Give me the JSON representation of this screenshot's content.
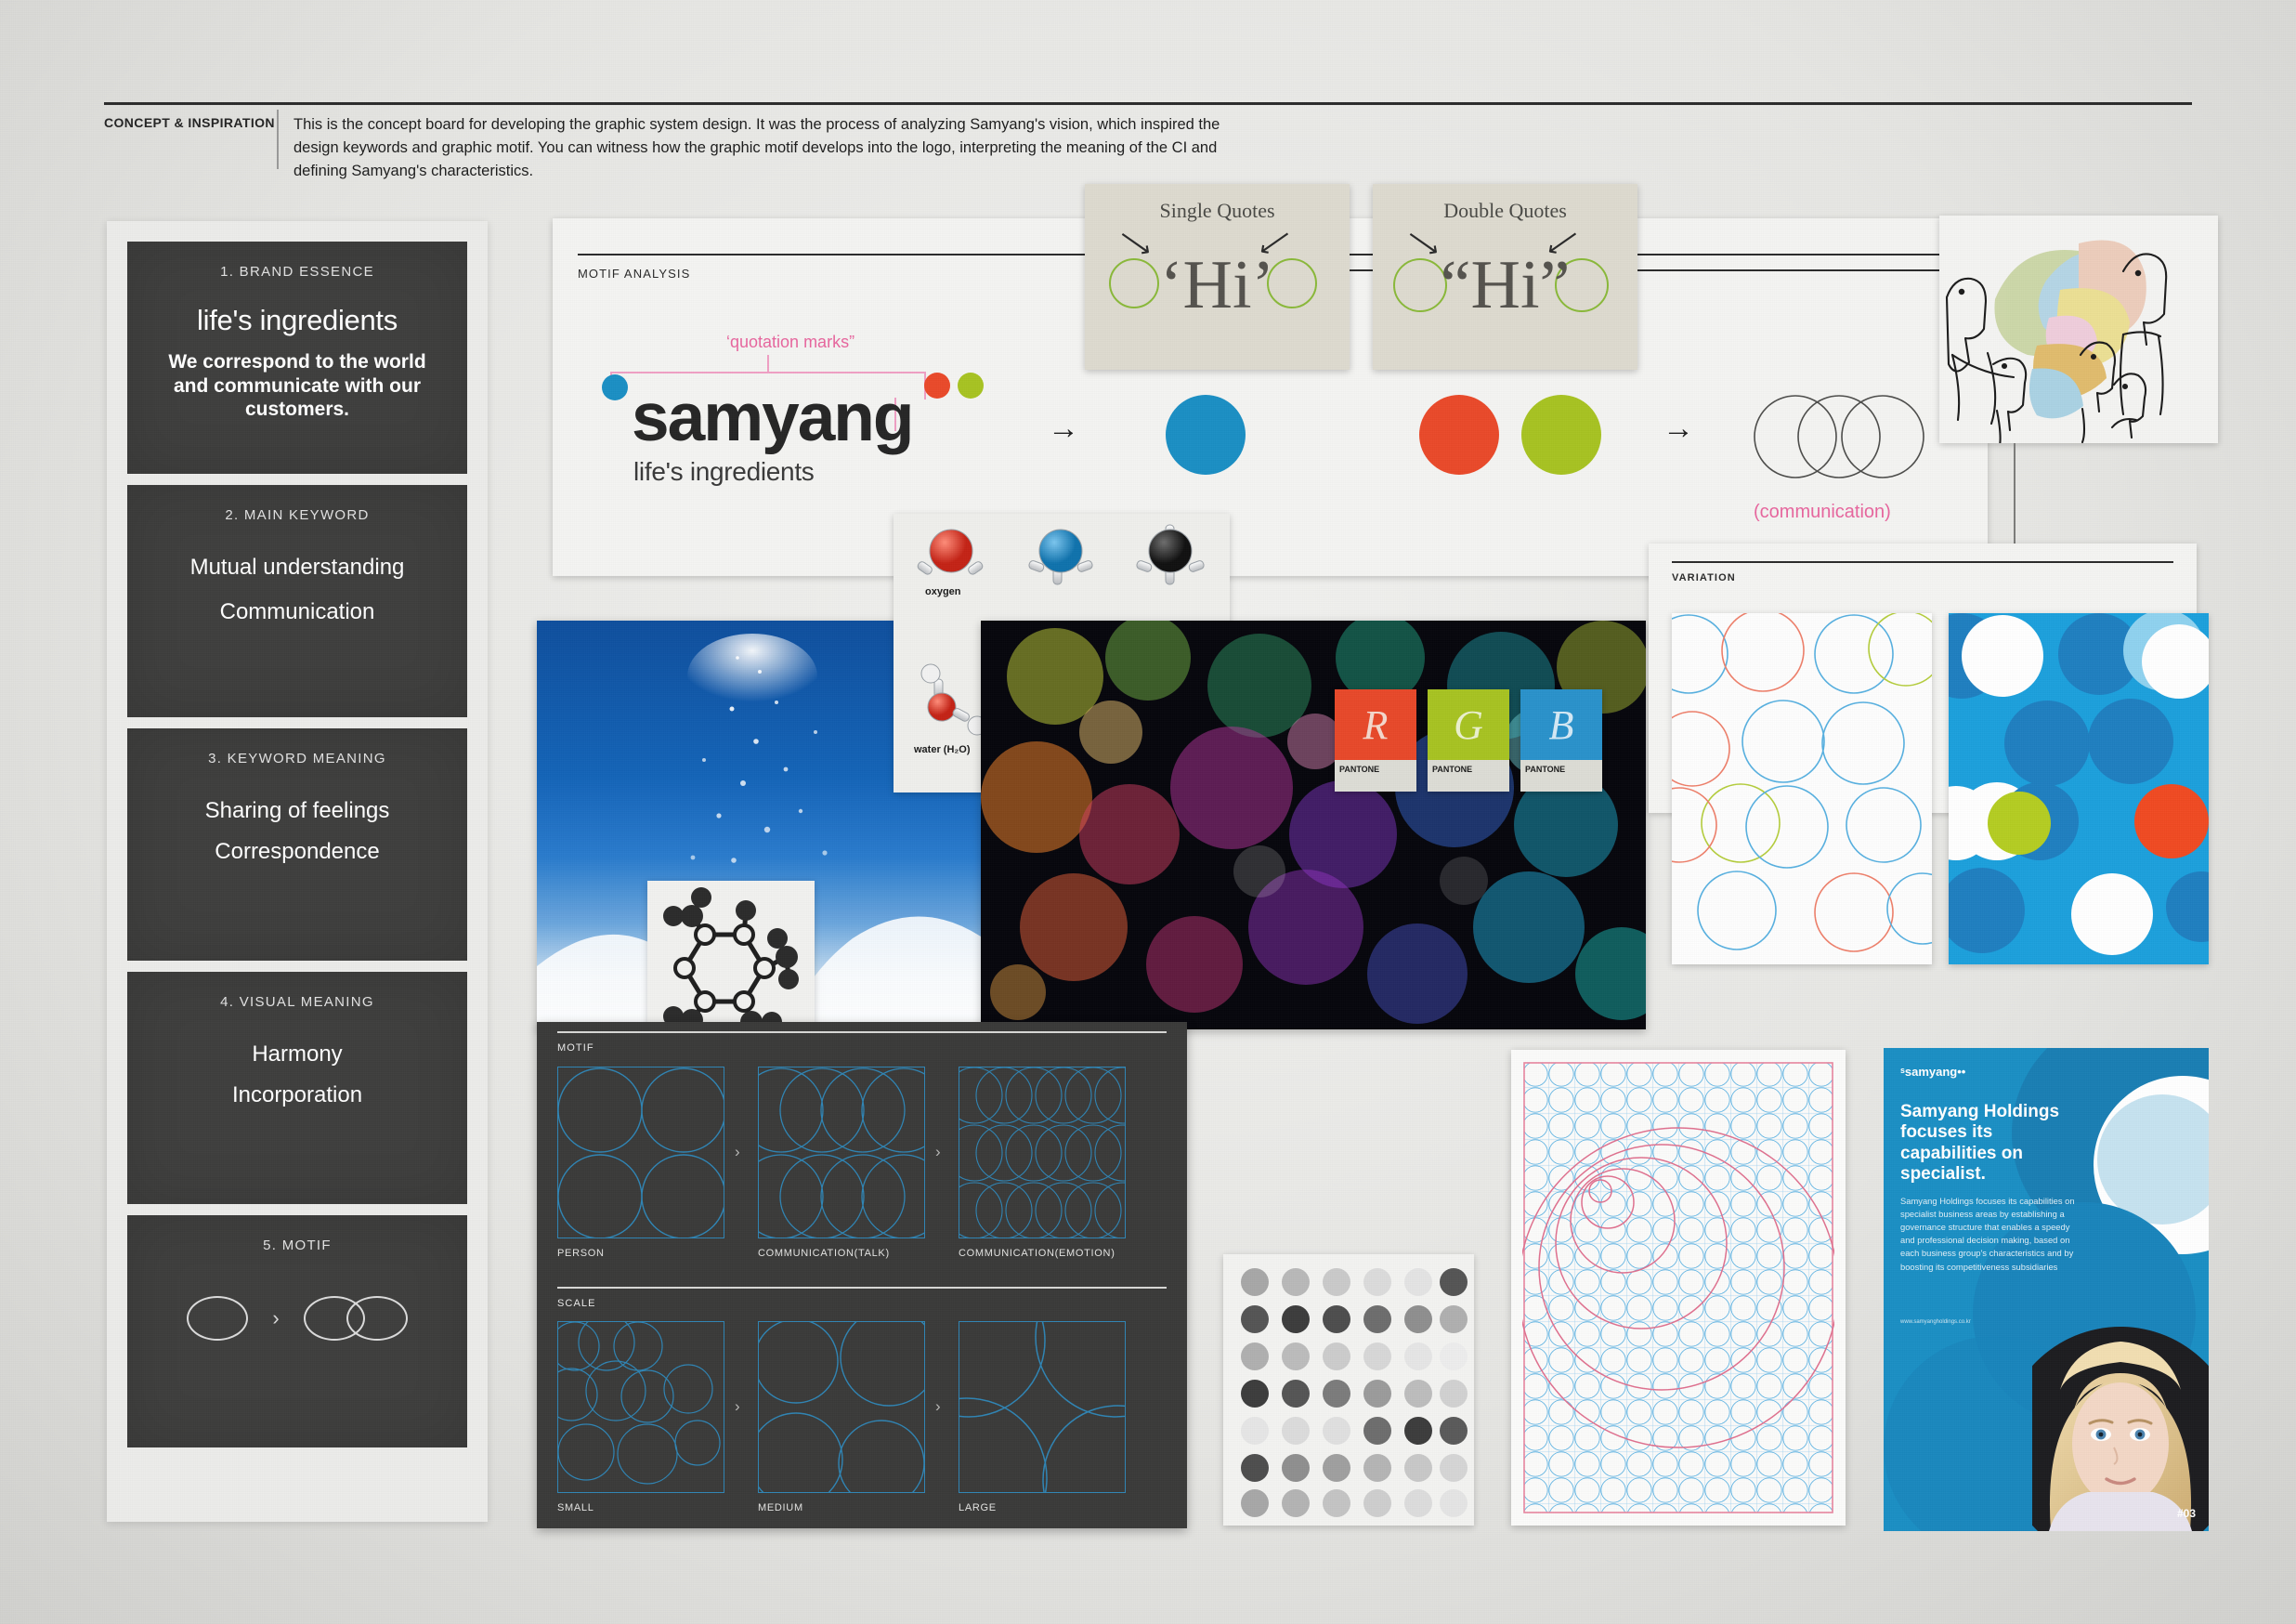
{
  "header": {
    "label": "CONCEPT & INSPIRATION",
    "body": "This is the concept board for developing the graphic system design. It was the process of analyzing Samyang's vision, which inspired the design keywords and graphic motif. You can witness how the graphic motif develops into the logo, interpreting the meaning of the CI and defining Samyang's characteristics."
  },
  "rail": {
    "panels": [
      {
        "num": "1. BRAND ESSENCE",
        "headline": "life's ingredients",
        "sub": "We correspond to the world and communicate with our customers.",
        "lines": []
      },
      {
        "num": "2. MAIN KEYWORD",
        "headline": "",
        "sub": "",
        "lines": [
          "Mutual understanding",
          "Communication"
        ]
      },
      {
        "num": "3. KEYWORD MEANING",
        "headline": "",
        "sub": "",
        "lines": [
          "Sharing of feelings",
          "Correspondence"
        ]
      },
      {
        "num": "4. VISUAL MEANING",
        "headline": "",
        "sub": "",
        "lines": [
          "Harmony",
          "Incorporation"
        ]
      },
      {
        "num": "5. MOTIF",
        "headline": "",
        "sub": "",
        "lines": []
      }
    ],
    "motif_chevron": "›"
  },
  "motif_analysis": {
    "section_label": "MOTIF ANALYSIS",
    "logo_word": "samyang",
    "logo_tagline": "life's ingredients",
    "annotation": "‘quotation marks”",
    "arrow": "→",
    "communication_label": "(communication)",
    "colors": {
      "blue": "#1b8fc4",
      "red": "#ea4a2a",
      "green": "#a8c322",
      "pink": "#e8679f"
    }
  },
  "quote_cards": [
    {
      "title": "Single Quotes",
      "text": "Hi",
      "open": "‘",
      "close": "’"
    },
    {
      "title": "Double Quotes",
      "text": "Hi",
      "open": "“",
      "close": "”"
    }
  ],
  "molecule_card": {
    "label_oxygen": "oxygen",
    "label_water": "water (H₂O)"
  },
  "pantone_cards": [
    {
      "letter": "R",
      "label": "PANTONE",
      "color": "#e8492a"
    },
    {
      "letter": "G",
      "label": "PANTONE",
      "color": "#a8c322"
    },
    {
      "letter": "B",
      "label": "PANTONE",
      "color": "#2a92cb"
    }
  ],
  "dark_board": {
    "sections": [
      {
        "title": "MOTIF",
        "items": [
          {
            "caption": "PERSON",
            "density": 2
          },
          {
            "caption": "COMMUNICATION(TALK)",
            "density": 4
          },
          {
            "caption": "COMMUNICATION(EMOTION)",
            "density": 6
          }
        ]
      },
      {
        "title": "SCALE",
        "items": [
          {
            "caption": "SMALL",
            "density": 5
          },
          {
            "caption": "MEDIUM",
            "density": 2
          },
          {
            "caption": "LARGE",
            "density": 1
          }
        ]
      }
    ],
    "chevron": "›",
    "stroke_color": "#2f85b5"
  },
  "variation": {
    "section_label": "VARIATION"
  },
  "brochure": {
    "logo": "ˢsamyang••",
    "headline": "Samyang Holdings focuses its capabilities on specialist.",
    "body": "Samyang Holdings focuses its capabilities on  specialist business areas by establishing a governance structure that enables a speedy and professional decision making, based on each business group's characteristics and by boosting its competitiveness subsidiaries",
    "url": "www.samyangholdings.co.kr",
    "page_number": "#03"
  }
}
